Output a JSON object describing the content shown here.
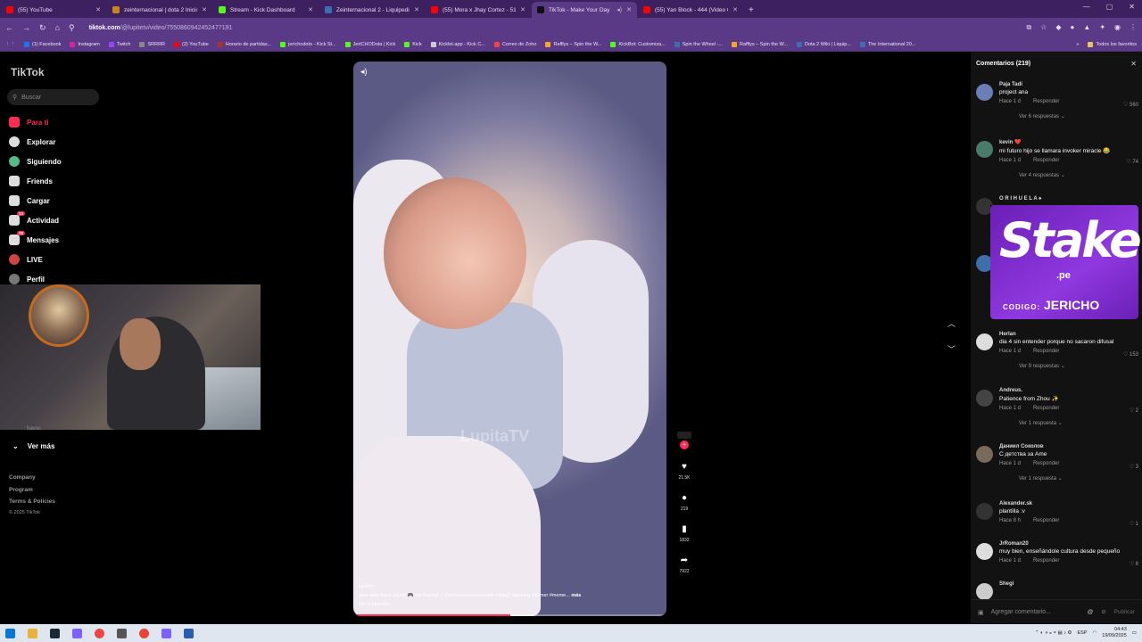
{
  "browser": {
    "tabs": [
      {
        "label": "(55) YouTube",
        "color": "#ff0000"
      },
      {
        "label": "zeinternacional | dota 2 Inicio",
        "color": "#c7861a"
      },
      {
        "label": "Stream - Kick Dashboard",
        "color": "#53fc18"
      },
      {
        "label": "Zeinternacional 2 - Liquipedia",
        "color": "#3a6fb0"
      },
      {
        "label": "(55) Mora x Jhay Cortez - 512 (",
        "color": "#ff0000"
      },
      {
        "label": "TikTok - Make Your Day",
        "color": "#111111"
      },
      {
        "label": "(55) Yan Block - 444 (Video Ofi",
        "color": "#ff0000"
      }
    ],
    "url_host": "tiktok.com",
    "url_path": "/@lupitetv/video/7550860942452477191",
    "bookmarks": [
      "(1) Facebook",
      "Instagram",
      "Twitch",
      "SRRRR",
      "(2) YouTube",
      "Horario de partidas...",
      "jerichodoto - Kick St...",
      "JeriCHODota | Kick",
      "Kick",
      "Kicklet.app - Kick C...",
      "Correo de Zoho",
      "Rafflys – Spin the W...",
      "KickBot: Customiza...",
      "Spin the Wheel -...",
      "Rafflys – Spin the W...",
      "Dota 2 Wiki | Liquip...",
      "The International 20..."
    ],
    "bookmarks_more": "Todos los favoritos"
  },
  "sidebar": {
    "logo": "TikTok",
    "search_placeholder": "Buscar",
    "items": [
      {
        "label": "Para ti"
      },
      {
        "label": "Explorar"
      },
      {
        "label": "Siguiendo"
      },
      {
        "label": "Friends"
      },
      {
        "label": "Cargar"
      },
      {
        "label": "Actividad",
        "badge": "14"
      },
      {
        "label": "Mensajes",
        "badge": "76"
      },
      {
        "label": "LIVE"
      },
      {
        "label": "Perfil"
      }
    ],
    "ver_mas": "Ver más",
    "footer": [
      "Company",
      "Program",
      "Terms & Policies"
    ],
    "copyright": "© 2025 TikTok",
    "webcam_caption": "havoc"
  },
  "video": {
    "watermark": "LupitaTV",
    "author": "lupitetv",
    "caption": "dota start them young 🎮 Ms Rachel ✓ Ceeeeeeeeeeeeeeeb! #dota2 #gaming #gamer #meme...",
    "caption_more": "más",
    "translate": "Ver traducción",
    "progress": 0.5
  },
  "actions": {
    "likes": "21.5K",
    "comments": "219",
    "saves": "1832",
    "shares": "7922"
  },
  "comments": {
    "title": "Comentarios (219)",
    "list": [
      {
        "user": "Paja Tadi",
        "text": "project ana",
        "time": "Hace 1 d",
        "reply": "Responder",
        "likes": "560",
        "more": "Ver 6 respuestas"
      },
      {
        "user": "kevin ❤️",
        "text": "mi futuro hijo se llamara invoker miracle 😂",
        "time": "Hace 1 d",
        "reply": "Responder",
        "likes": "74",
        "more": "Ver 4 respuestas"
      },
      {
        "user": "O R I H U E L A ♠",
        "text": "",
        "time": "",
        "reply": "",
        "likes": "",
        "more": ""
      },
      {
        "user": "Herlan",
        "text": "dia 4 sin entender porque no sacaron difusal",
        "time": "Hace 1 d",
        "reply": "Responder",
        "likes": "153",
        "more": "Ver 9 respuestas"
      },
      {
        "user": "Andreus.",
        "text": "Patience from Zhou ✨",
        "time": "Hace 1 d",
        "reply": "Responder",
        "likes": "2",
        "more": "Ver 1 respuesta"
      },
      {
        "user": "Даниил Соколов",
        "text": "С детства за Ame",
        "time": "Hace 1 d",
        "reply": "Responder",
        "likes": "3",
        "more": "Ver 1 respuesta"
      },
      {
        "user": "Alexander.sk",
        "text": "plantilla :v",
        "time": "Hace 8 h",
        "reply": "Responder",
        "likes": "1",
        "more": ""
      },
      {
        "user": "JrRoman20",
        "text": "muy bien, enseñándole cultura desde pequeño",
        "time": "Hace 1 d",
        "reply": "Responder",
        "likes": "8",
        "more": ""
      },
      {
        "user": "Shegi",
        "text": "",
        "time": "",
        "reply": "",
        "likes": "",
        "more": ""
      }
    ],
    "add_placeholder": "Agregar comentario...",
    "publish": "Publicar"
  },
  "overlay": {
    "brand": "Stake",
    "tld": ".pe",
    "code_label": "CODIGO:",
    "code": "JERICHO"
  },
  "taskbar": {
    "lang": "ESP",
    "time": "04:43",
    "date": "19/09/2025"
  },
  "colors": {
    "accent": "#fe2c55",
    "browser": "#5a3a86",
    "stake": "#8f38e0"
  }
}
